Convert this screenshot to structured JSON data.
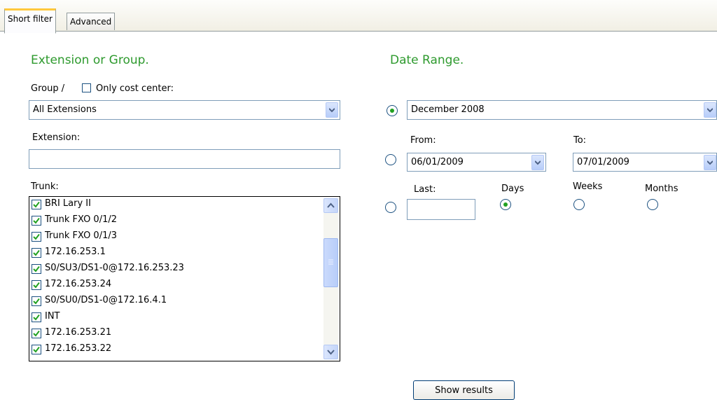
{
  "tabs": [
    {
      "label": "Short filter",
      "active": true
    },
    {
      "label": "Advanced",
      "active": false
    }
  ],
  "extension_section": {
    "title": "Extension or Group.",
    "group_label": "Group /",
    "only_cost_center_label": "Only cost center:",
    "only_cost_center_checked": false,
    "group_value": "All Extensions",
    "extension_label": "Extension:",
    "extension_value": "",
    "trunk_label": "Trunk:",
    "trunks": [
      {
        "label": "BRI Lary II",
        "checked": true
      },
      {
        "label": "Trunk FXO 0/1/2",
        "checked": true
      },
      {
        "label": "Trunk FXO 0/1/3",
        "checked": true
      },
      {
        "label": "172.16.253.1",
        "checked": true
      },
      {
        "label": "S0/SU3/DS1-0@172.16.253.23",
        "checked": true
      },
      {
        "label": "172.16.253.24",
        "checked": true
      },
      {
        "label": "S0/SU0/DS1-0@172.16.4.1",
        "checked": true
      },
      {
        "label": "INT",
        "checked": true
      },
      {
        "label": "172.16.253.21",
        "checked": true
      },
      {
        "label": "172.16.253.22",
        "checked": true
      }
    ]
  },
  "date_section": {
    "title": "Date Range.",
    "month_value": "December 2008",
    "from_label": "From:",
    "from_value": "06/01/2009",
    "to_label": "To:",
    "to_value": "07/01/2009",
    "last_label": "Last:",
    "last_value": "",
    "days_label": "Days",
    "weeks_label": "Weeks",
    "months_label": "Months",
    "selected_range": "month",
    "selected_unit": "days"
  },
  "show_results_label": "Show results",
  "colors": {
    "section_title": "#2e9a2e",
    "radio_dot": "#21a121",
    "check_mark": "#21a121"
  }
}
